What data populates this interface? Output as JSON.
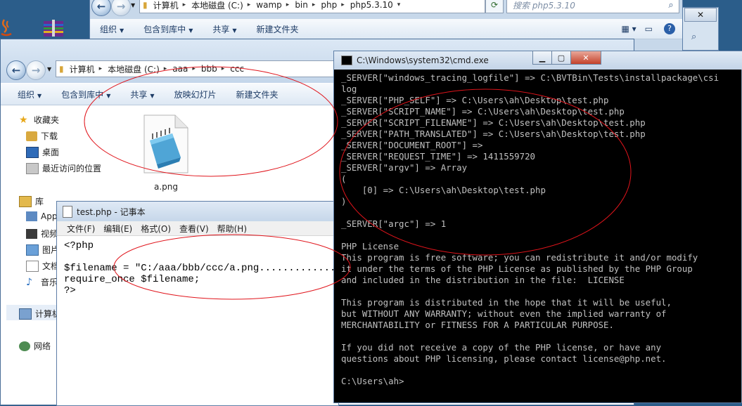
{
  "desktop": {
    "icons": [
      "java-app-icon",
      "archive-app-icon"
    ]
  },
  "explorer_back": {
    "breadcrumb": [
      "计算机",
      "本地磁盘 (C:)",
      "wamp",
      "bin",
      "php",
      "php5.3.10"
    ],
    "search_placeholder": "搜索 php5.3.10",
    "toolbar": [
      "组织",
      "包含到库中",
      "共享",
      "新建文件夹"
    ]
  },
  "explorer": {
    "breadcrumb": [
      "计算机",
      "本地磁盘 (C:)",
      "aaa",
      "bbb",
      "ccc"
    ],
    "toolbar": [
      "组织",
      "包含到库中",
      "共享",
      "放映幻灯片",
      "新建文件夹"
    ],
    "favorites_header": "收藏夹",
    "favorites": [
      "下载",
      "桌面",
      "最近访问的位置"
    ],
    "library_header": "库",
    "libraries": [
      "App",
      "视频",
      "图片",
      "文档",
      "音乐"
    ],
    "computer": "计算机",
    "network": "网络",
    "file_name": "a.png"
  },
  "notepad": {
    "title": "test.php - 记事本",
    "menu": [
      "文件(F)",
      "编辑(E)",
      "格式(O)",
      "查看(V)",
      "帮助(H)"
    ],
    "lines": [
      "<?php",
      "",
      "$filename = \"C:/aaa/bbb/ccc/a.png.................",
      "require_once $filename;",
      "?>"
    ]
  },
  "cmd": {
    "title": "C:\\Windows\\system32\\cmd.exe",
    "lines": [
      "_SERVER[\"windows_tracing_logfile\"] => C:\\BVTBin\\Tests\\installpackage\\csi",
      "log",
      "_SERVER[\"PHP_SELF\"] => C:\\Users\\ah\\Desktop\\test.php",
      "_SERVER[\"SCRIPT_NAME\"] => C:\\Users\\ah\\Desktop\\test.php",
      "_SERVER[\"SCRIPT_FILENAME\"] => C:\\Users\\ah\\Desktop\\test.php",
      "_SERVER[\"PATH_TRANSLATED\"] => C:\\Users\\ah\\Desktop\\test.php",
      "_SERVER[\"DOCUMENT_ROOT\"] =>",
      "_SERVER[\"REQUEST_TIME\"] => 1411559720",
      "_SERVER[\"argv\"] => Array",
      "(",
      "    [0] => C:\\Users\\ah\\Desktop\\test.php",
      ")",
      "",
      "_SERVER[\"argc\"] => 1",
      "",
      "PHP License",
      "This program is free software; you can redistribute it and/or modify",
      "it under the terms of the PHP License as published by the PHP Group",
      "and included in the distribution in the file:  LICENSE",
      "",
      "This program is distributed in the hope that it will be useful,",
      "but WITHOUT ANY WARRANTY; without even the implied warranty of",
      "MERCHANTABILITY or FITNESS FOR A PARTICULAR PURPOSE.",
      "",
      "If you did not receive a copy of the PHP license, or have any",
      "questions about PHP licensing, please contact license@php.net.",
      "",
      "C:\\Users\\ah>"
    ]
  },
  "colors": {
    "annotation": "#e0141b",
    "cmd_bg": "#000000",
    "cmd_text": "#c0c0c0"
  }
}
